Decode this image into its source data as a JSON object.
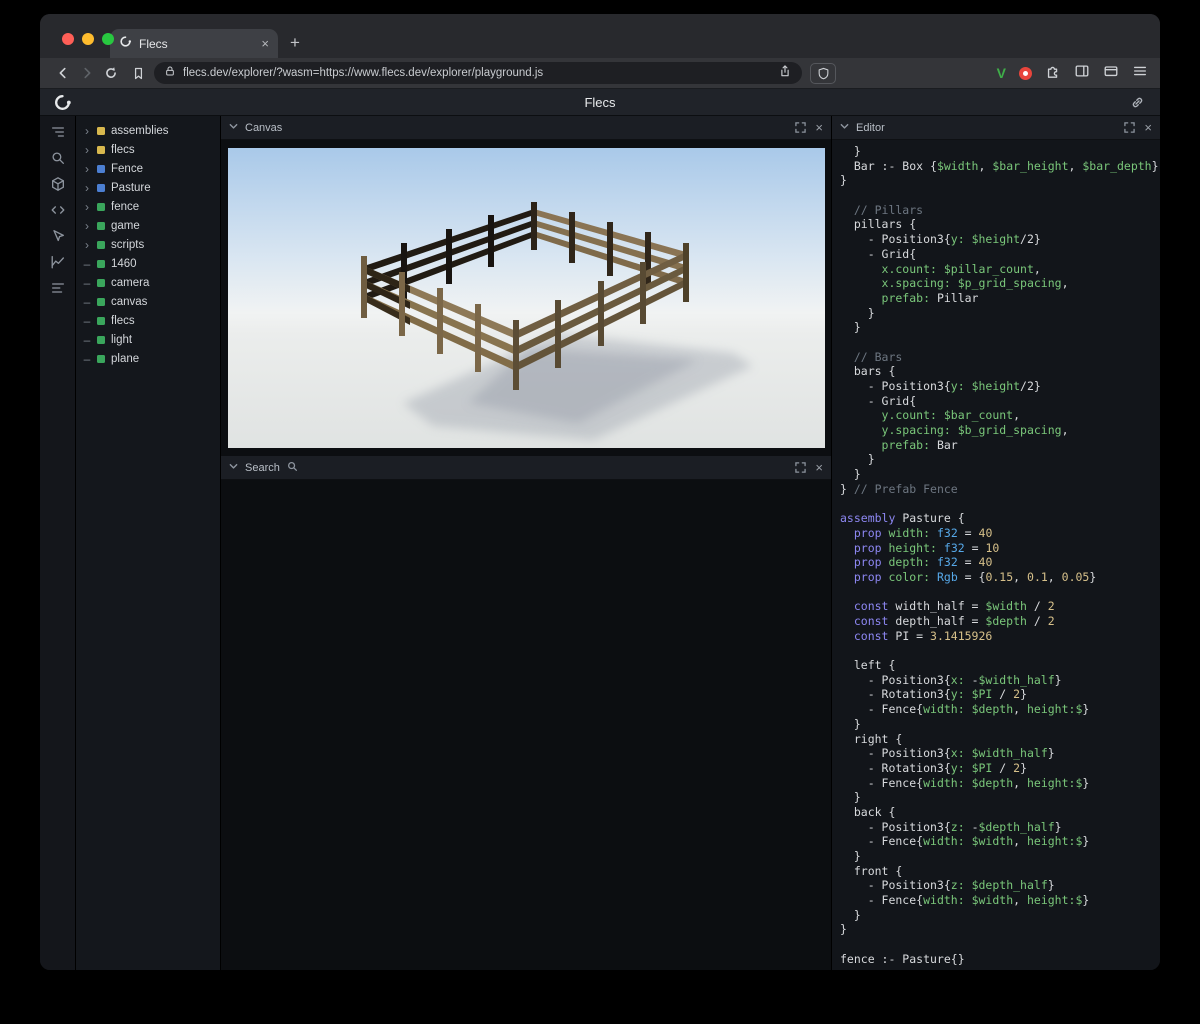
{
  "browser": {
    "tab_title": "Flecs",
    "tab_close_label": "×",
    "new_tab_label": "+",
    "url": "flecs.dev/explorer/?wasm=https://www.flecs.dev/explorer/playground.js",
    "extension_v_label": "V"
  },
  "header": {
    "title": "Flecs"
  },
  "sidebar_icons": [
    "entity-tree-icon",
    "search-icon",
    "cube-icon",
    "code-icon",
    "inspector-icon",
    "chart-icon",
    "stats-icon"
  ],
  "tree": {
    "items": [
      {
        "expandable": true,
        "color": "yellow",
        "label": "assemblies"
      },
      {
        "expandable": true,
        "color": "yellow",
        "label": "flecs"
      },
      {
        "expandable": true,
        "color": "blue",
        "label": "Fence"
      },
      {
        "expandable": true,
        "color": "blue",
        "label": "Pasture"
      },
      {
        "expandable": true,
        "color": "green",
        "label": "fence"
      },
      {
        "expandable": true,
        "color": "green",
        "label": "game"
      },
      {
        "expandable": true,
        "color": "green",
        "label": "scripts"
      },
      {
        "expandable": false,
        "color": "green",
        "label": "1460"
      },
      {
        "expandable": false,
        "color": "green",
        "label": "camera"
      },
      {
        "expandable": false,
        "color": "green",
        "label": "canvas"
      },
      {
        "expandable": false,
        "color": "green",
        "label": "flecs"
      },
      {
        "expandable": false,
        "color": "green",
        "label": "light"
      },
      {
        "expandable": false,
        "color": "green",
        "label": "plane"
      }
    ]
  },
  "panels": {
    "canvas": {
      "title": "Canvas"
    },
    "search": {
      "title": "Search"
    },
    "editor": {
      "title": "Editor"
    },
    "close_label": "×"
  },
  "colors": {
    "square_yellow": "#d8b84e",
    "square_blue": "#4c7fd2",
    "square_green": "#3aa65c",
    "code_keyword": "#8d87f2",
    "code_type": "#56a8e8",
    "code_green": "#7ac77a",
    "code_number": "#d6c08a",
    "code_comment": "#6d7681",
    "code_plain": "#d8dadd",
    "traffic_red": "#ff5f57",
    "traffic_yellow": "#febc2e",
    "traffic_green": "#28c840",
    "brave_v_green": "#3fae49",
    "ext_red": "#e8453c"
  },
  "editor": {
    "lines": [
      [
        [
          "p",
          "  }"
        ]
      ],
      [
        [
          "p",
          "  Bar :- Box {"
        ],
        [
          "g",
          "$width"
        ],
        [
          "p",
          ", "
        ],
        [
          "g",
          "$bar_height"
        ],
        [
          "p",
          ", "
        ],
        [
          "g",
          "$bar_depth"
        ],
        [
          "p",
          "}"
        ]
      ],
      [
        [
          "p",
          "}"
        ]
      ],
      [],
      [
        [
          "c",
          "  // Pillars"
        ]
      ],
      [
        [
          "p",
          "  pillars {"
        ]
      ],
      [
        [
          "p",
          "    - Position3{"
        ],
        [
          "g",
          "y:"
        ],
        [
          "p",
          " "
        ],
        [
          "g",
          "$height"
        ],
        [
          "p",
          "/2}"
        ]
      ],
      [
        [
          "p",
          "    - Grid{"
        ]
      ],
      [
        [
          "g",
          "      x.count:"
        ],
        [
          "p",
          " "
        ],
        [
          "g",
          "$pillar_count"
        ],
        [
          "p",
          ","
        ]
      ],
      [
        [
          "g",
          "      x.spacing:"
        ],
        [
          "p",
          " "
        ],
        [
          "g",
          "$p_grid_spacing"
        ],
        [
          "p",
          ","
        ]
      ],
      [
        [
          "g",
          "      prefab:"
        ],
        [
          "p",
          " Pillar"
        ]
      ],
      [
        [
          "p",
          "    }"
        ]
      ],
      [
        [
          "p",
          "  }"
        ]
      ],
      [],
      [
        [
          "c",
          "  // Bars"
        ]
      ],
      [
        [
          "p",
          "  bars {"
        ]
      ],
      [
        [
          "p",
          "    - Position3{"
        ],
        [
          "g",
          "y:"
        ],
        [
          "p",
          " "
        ],
        [
          "g",
          "$height"
        ],
        [
          "p",
          "/2}"
        ]
      ],
      [
        [
          "p",
          "    - Grid{"
        ]
      ],
      [
        [
          "g",
          "      y.count:"
        ],
        [
          "p",
          " "
        ],
        [
          "g",
          "$bar_count"
        ],
        [
          "p",
          ","
        ]
      ],
      [
        [
          "g",
          "      y.spacing:"
        ],
        [
          "p",
          " "
        ],
        [
          "g",
          "$b_grid_spacing"
        ],
        [
          "p",
          ","
        ]
      ],
      [
        [
          "g",
          "      prefab:"
        ],
        [
          "p",
          " Bar"
        ]
      ],
      [
        [
          "p",
          "    }"
        ]
      ],
      [
        [
          "p",
          "  }"
        ]
      ],
      [
        [
          "p",
          "} "
        ],
        [
          "c",
          "// Prefab Fence"
        ]
      ],
      [],
      [
        [
          "k",
          "assembly"
        ],
        [
          "p",
          " Pasture {"
        ]
      ],
      [
        [
          "k",
          "  prop"
        ],
        [
          "p",
          " "
        ],
        [
          "g",
          "width:"
        ],
        [
          "p",
          " "
        ],
        [
          "t",
          "f32"
        ],
        [
          "p",
          " = "
        ],
        [
          "n",
          "40"
        ]
      ],
      [
        [
          "k",
          "  prop"
        ],
        [
          "p",
          " "
        ],
        [
          "g",
          "height:"
        ],
        [
          "p",
          " "
        ],
        [
          "t",
          "f32"
        ],
        [
          "p",
          " = "
        ],
        [
          "n",
          "10"
        ]
      ],
      [
        [
          "k",
          "  prop"
        ],
        [
          "p",
          " "
        ],
        [
          "g",
          "depth:"
        ],
        [
          "p",
          " "
        ],
        [
          "t",
          "f32"
        ],
        [
          "p",
          " = "
        ],
        [
          "n",
          "40"
        ]
      ],
      [
        [
          "k",
          "  prop"
        ],
        [
          "p",
          " "
        ],
        [
          "g",
          "color:"
        ],
        [
          "p",
          " "
        ],
        [
          "t",
          "Rgb"
        ],
        [
          "p",
          " = {"
        ],
        [
          "n",
          "0.15"
        ],
        [
          "p",
          ", "
        ],
        [
          "n",
          "0.1"
        ],
        [
          "p",
          ", "
        ],
        [
          "n",
          "0.05"
        ],
        [
          "p",
          "}"
        ]
      ],
      [],
      [
        [
          "k",
          "  const"
        ],
        [
          "p",
          " width_half = "
        ],
        [
          "g",
          "$width"
        ],
        [
          "p",
          " / "
        ],
        [
          "n",
          "2"
        ]
      ],
      [
        [
          "k",
          "  const"
        ],
        [
          "p",
          " depth_half = "
        ],
        [
          "g",
          "$depth"
        ],
        [
          "p",
          " / "
        ],
        [
          "n",
          "2"
        ]
      ],
      [
        [
          "k",
          "  const"
        ],
        [
          "p",
          " PI = "
        ],
        [
          "n",
          "3.1415926"
        ]
      ],
      [],
      [
        [
          "p",
          "  left {"
        ]
      ],
      [
        [
          "p",
          "    - Position3{"
        ],
        [
          "g",
          "x:"
        ],
        [
          "p",
          " -"
        ],
        [
          "g",
          "$width_half"
        ],
        [
          "p",
          "}"
        ]
      ],
      [
        [
          "p",
          "    - Rotation3{"
        ],
        [
          "g",
          "y:"
        ],
        [
          "p",
          " "
        ],
        [
          "g",
          "$PI"
        ],
        [
          "p",
          " / "
        ],
        [
          "n",
          "2"
        ],
        [
          "p",
          "}"
        ]
      ],
      [
        [
          "p",
          "    - Fence{"
        ],
        [
          "g",
          "width:"
        ],
        [
          "p",
          " "
        ],
        [
          "g",
          "$depth"
        ],
        [
          "p",
          ", "
        ],
        [
          "g",
          "height:$"
        ],
        [
          "p",
          "}"
        ]
      ],
      [
        [
          "p",
          "  }"
        ]
      ],
      [
        [
          "p",
          "  right {"
        ]
      ],
      [
        [
          "p",
          "    - Position3{"
        ],
        [
          "g",
          "x:"
        ],
        [
          "p",
          " "
        ],
        [
          "g",
          "$width_half"
        ],
        [
          "p",
          "}"
        ]
      ],
      [
        [
          "p",
          "    - Rotation3{"
        ],
        [
          "g",
          "y:"
        ],
        [
          "p",
          " "
        ],
        [
          "g",
          "$PI"
        ],
        [
          "p",
          " / "
        ],
        [
          "n",
          "2"
        ],
        [
          "p",
          "}"
        ]
      ],
      [
        [
          "p",
          "    - Fence{"
        ],
        [
          "g",
          "width:"
        ],
        [
          "p",
          " "
        ],
        [
          "g",
          "$depth"
        ],
        [
          "p",
          ", "
        ],
        [
          "g",
          "height:$"
        ],
        [
          "p",
          "}"
        ]
      ],
      [
        [
          "p",
          "  }"
        ]
      ],
      [
        [
          "p",
          "  back {"
        ]
      ],
      [
        [
          "p",
          "    - Position3{"
        ],
        [
          "g",
          "z:"
        ],
        [
          "p",
          " -"
        ],
        [
          "g",
          "$depth_half"
        ],
        [
          "p",
          "}"
        ]
      ],
      [
        [
          "p",
          "    - Fence{"
        ],
        [
          "g",
          "width:"
        ],
        [
          "p",
          " "
        ],
        [
          "g",
          "$width"
        ],
        [
          "p",
          ", "
        ],
        [
          "g",
          "height:$"
        ],
        [
          "p",
          "}"
        ]
      ],
      [
        [
          "p",
          "  }"
        ]
      ],
      [
        [
          "p",
          "  front {"
        ]
      ],
      [
        [
          "p",
          "    - Position3{"
        ],
        [
          "g",
          "z:"
        ],
        [
          "p",
          " "
        ],
        [
          "g",
          "$depth_half"
        ],
        [
          "p",
          "}"
        ]
      ],
      [
        [
          "p",
          "    - Fence{"
        ],
        [
          "g",
          "width:"
        ],
        [
          "p",
          " "
        ],
        [
          "g",
          "$width"
        ],
        [
          "p",
          ", "
        ],
        [
          "g",
          "height:$"
        ],
        [
          "p",
          "}"
        ]
      ],
      [
        [
          "p",
          "  }"
        ]
      ],
      [
        [
          "p",
          "}"
        ]
      ],
      [],
      [
        [
          "p",
          "fence :- Pasture{}"
        ]
      ]
    ]
  }
}
